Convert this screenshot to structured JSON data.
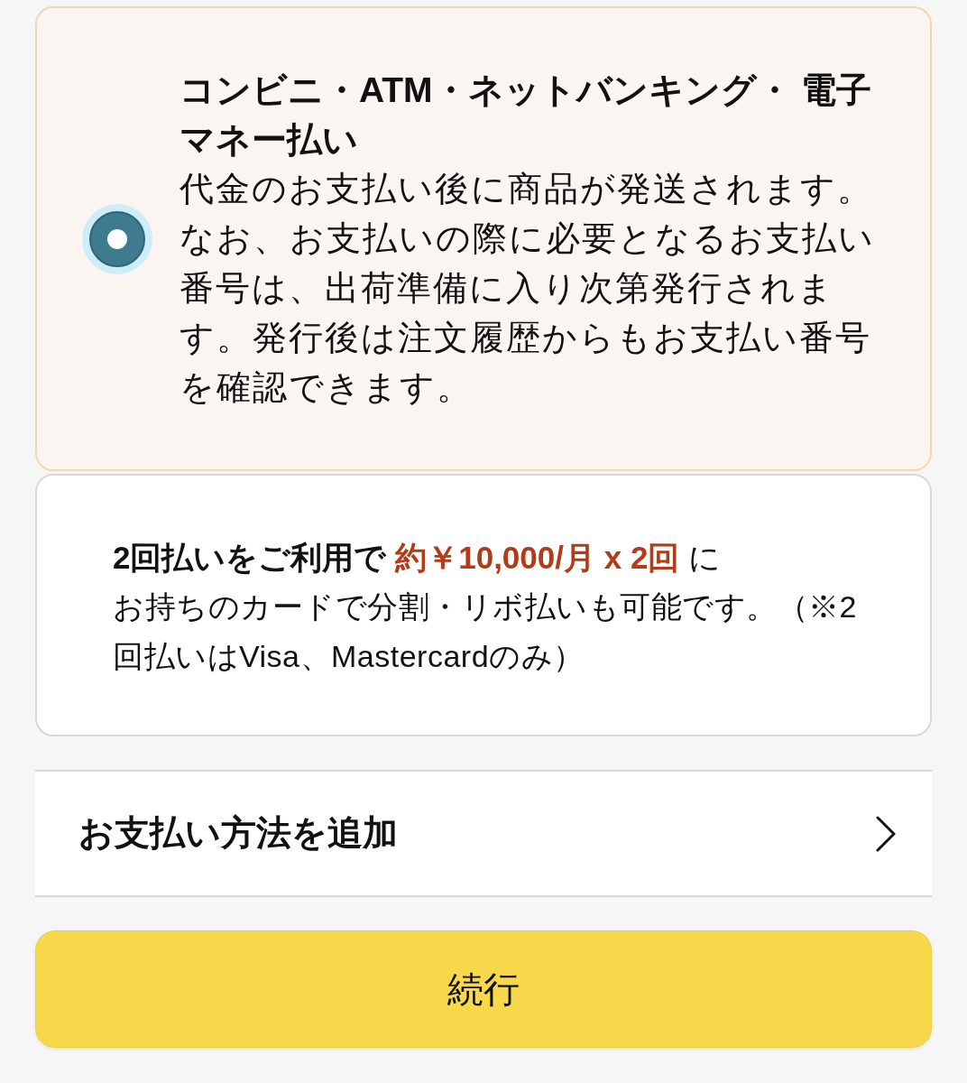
{
  "payment_option": {
    "selected": true,
    "title": "コンビニ・ATM・ネットバンキング・ 電子マネー払い",
    "description": "代金のお支払い後に商品が発送されます。なお、お支払いの際に必要となるお支払い番号は、出荷準備に入り次第発行されます。発行後は注文履歴からもお支払い番号を確認できます。"
  },
  "installment_note": {
    "lead": "2回払いをご利用で",
    "amount": "約￥10,000/月 x 2回",
    "tail": "に",
    "detail": "お持ちのカードで分割・リボ払いも可能です。（※2回払いはVisa、Mastercardのみ）"
  },
  "add_payment_method": {
    "label": "お支払い方法を追加"
  },
  "continue_button": {
    "label": "続行"
  }
}
